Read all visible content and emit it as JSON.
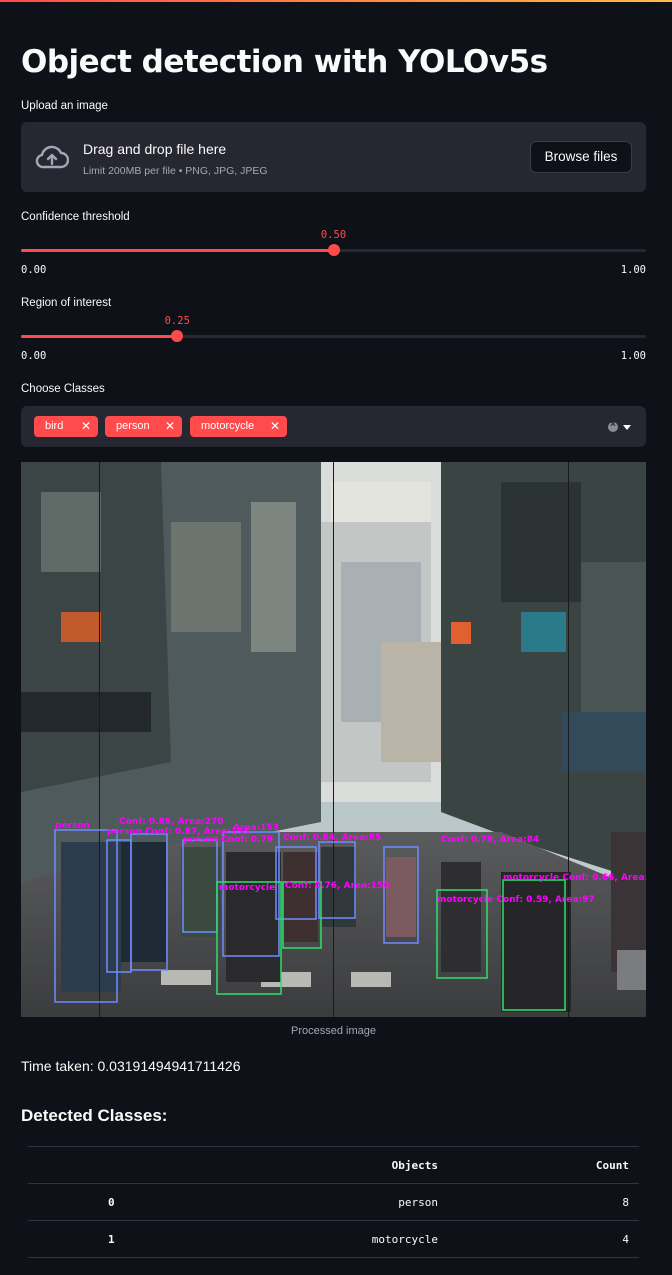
{
  "app": {
    "title": "Object detection with YOLOv5s"
  },
  "uploader": {
    "label": "Upload an image",
    "drop_title": "Drag and drop file here",
    "limit_text": "Limit 200MB per file • PNG, JPG, JPEG",
    "browse_label": "Browse files",
    "icon": "cloud-upload-icon"
  },
  "confidence": {
    "label": "Confidence threshold",
    "value": "0.50",
    "min": "0.00",
    "max": "1.00",
    "fraction": 0.5
  },
  "roi": {
    "label": "Region of interest",
    "value": "0.25",
    "min": "0.00",
    "max": "1.00",
    "fraction": 0.25
  },
  "classes": {
    "label": "Choose Classes",
    "selected": [
      "bird",
      "person",
      "motorcycle"
    ]
  },
  "image": {
    "caption": "Processed image",
    "detections": [
      "person",
      "Conf: 0.89, Area:270",
      "person Conf: 0.87, Area:195",
      "person Conf: 0.79",
      "Area:153",
      "Conf: 0.84, Area:85",
      "Conf: 0.79, Area:84",
      "motorcycle Conf: 0.66, Area:",
      "motorcycle",
      "Conf: 0.76, Area:150",
      "motorcycle Conf: 0.59, Area:97"
    ]
  },
  "timing": {
    "text": "Time taken: 0.03191494941711426"
  },
  "results": {
    "title": "Detected Classes:",
    "columns": [
      "",
      "Objects",
      "Count"
    ],
    "rows": [
      {
        "index": "0",
        "object": "person",
        "count": "8"
      },
      {
        "index": "1",
        "object": "motorcycle",
        "count": "4"
      }
    ]
  },
  "colors": {
    "background": "#0e1117",
    "accent": "#ff4b4b",
    "panel": "#262730",
    "box_person": "#6f8cff",
    "box_motorcycle": "#2ee06a",
    "label_text": "#ff00ff"
  }
}
